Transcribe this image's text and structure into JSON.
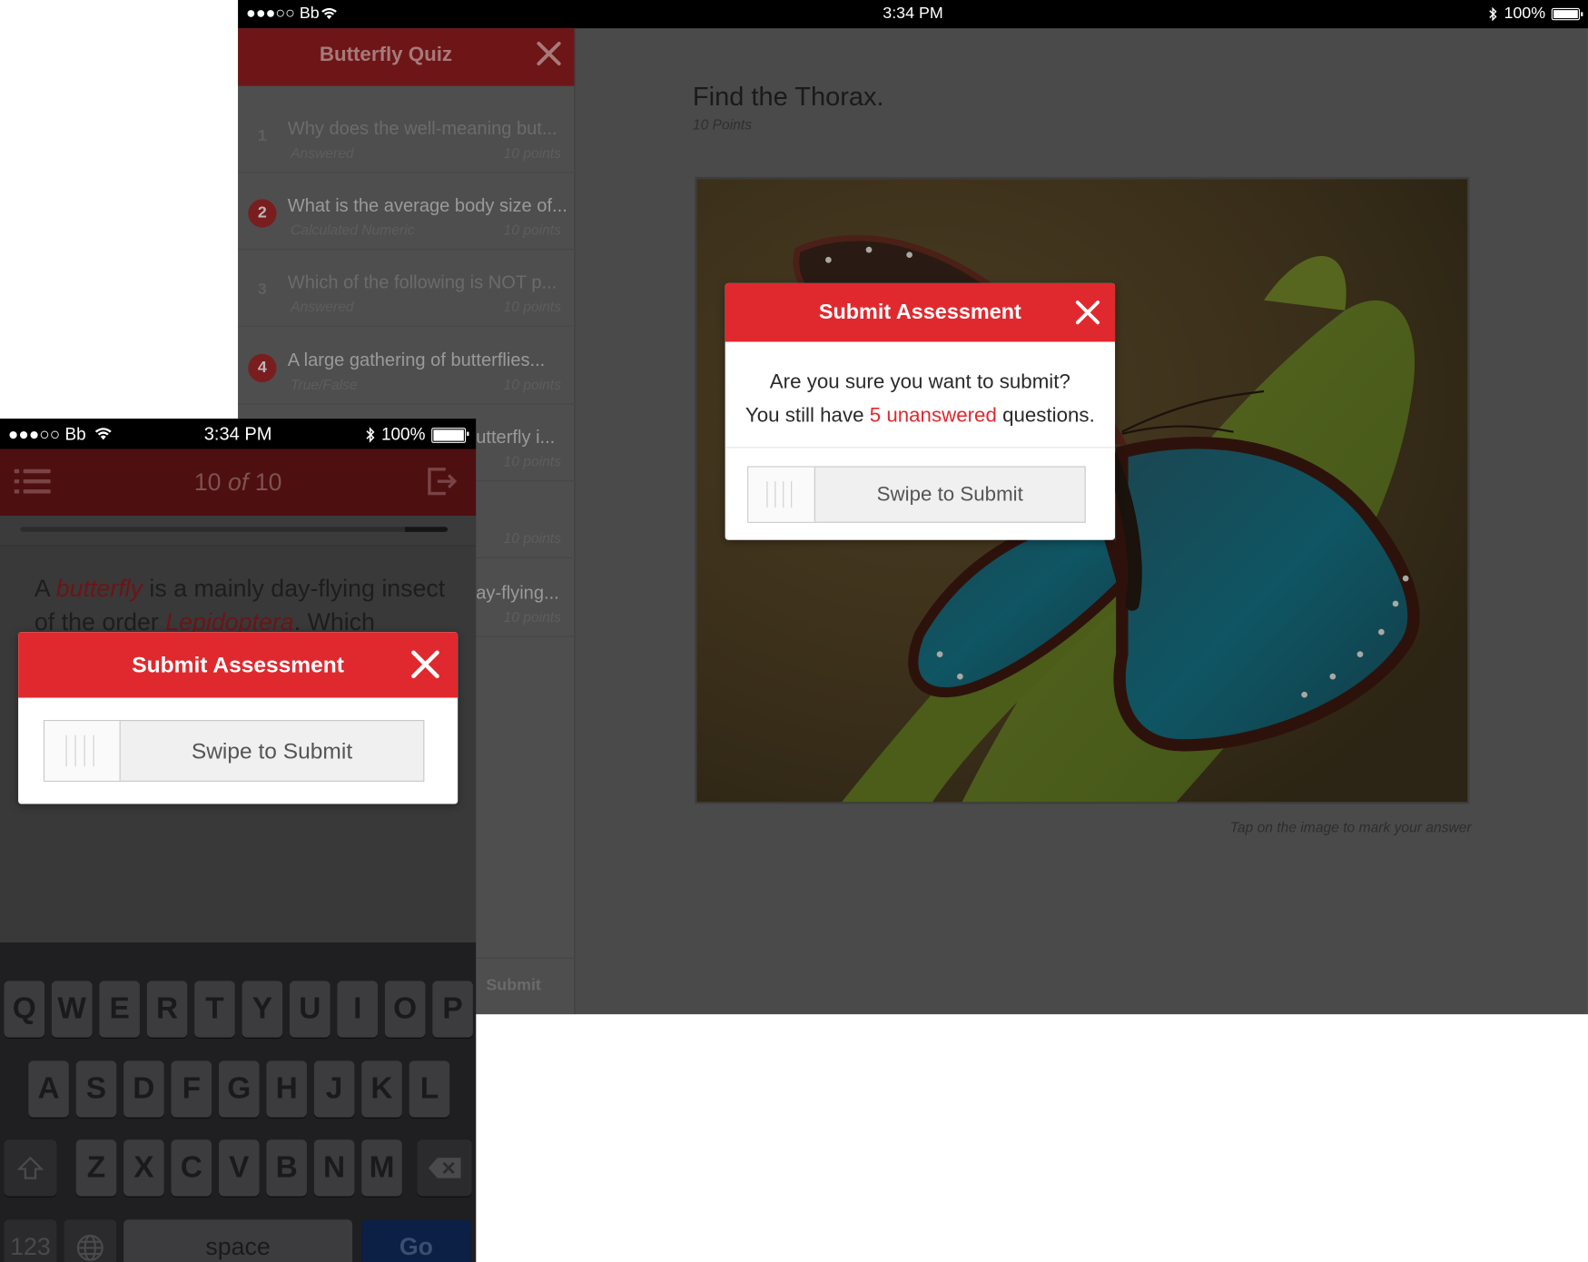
{
  "ipad": {
    "status": {
      "left": "●●●○○ Bb",
      "time": "3:34 PM",
      "battery": "100%"
    },
    "sidebar": {
      "title": "Butterfly Quiz",
      "submit_label": "Submit",
      "questions": [
        {
          "num": "1",
          "title": "Why does the well-meaning but...",
          "type": "Answered",
          "points": "10 points"
        },
        {
          "num": "2",
          "title": "What is the average body size of...",
          "type": "Calculated Numeric",
          "points": "10 points"
        },
        {
          "num": "3",
          "title": "Which of the following is NOT p...",
          "type": "Answered",
          "points": "10 points"
        },
        {
          "num": "4",
          "title": "A large gathering of butterflies...",
          "type": "True/False",
          "points": "10 points"
        },
        {
          "num": "",
          "title": "utterfly i...",
          "type": "",
          "points": "10 points"
        },
        {
          "num": "",
          "title": "",
          "type": "",
          "points": "10 points"
        },
        {
          "num": "",
          "title": "ay-flying...",
          "type": "",
          "points": "10 points"
        }
      ]
    },
    "main": {
      "title": "Find the Thorax.",
      "points": "10 Points",
      "hint": "Tap on the image to mark your answer"
    },
    "modal": {
      "title": "Submit Assessment",
      "line1": "Are you sure you want to submit?",
      "line2_pre": "You still have ",
      "line2_highlight": "5 unanswered",
      "line2_post": " questions.",
      "swipe_label": "Swipe to Submit"
    }
  },
  "iphone": {
    "status": {
      "left": "●●●○○ Bb",
      "time": "3:34 PM",
      "battery": "100%"
    },
    "nav": {
      "count": "10",
      "of": "of",
      "total": "10"
    },
    "progress": 1.0,
    "question": {
      "w1": "A",
      "w2": "butterfly",
      "w3": "is a mainly day-flying",
      "w4": "insect of the order",
      "w5": "Lepidoptera",
      "w6": ". Which"
    },
    "modal": {
      "title": "Submit Assessment",
      "swipe_label": "Swipe to Submit"
    },
    "keyboard": {
      "row1": [
        "Q",
        "W",
        "E",
        "R",
        "T",
        "Y",
        "U",
        "I",
        "O",
        "P"
      ],
      "row2": [
        "A",
        "S",
        "D",
        "F",
        "G",
        "H",
        "J",
        "K",
        "L"
      ],
      "row3": [
        "Z",
        "X",
        "C",
        "V",
        "B",
        "N",
        "M"
      ],
      "numbers": "123",
      "space": "space",
      "go": "Go"
    }
  },
  "colors": {
    "accent": "#e0292e",
    "nav_dark": "#6e1518"
  }
}
